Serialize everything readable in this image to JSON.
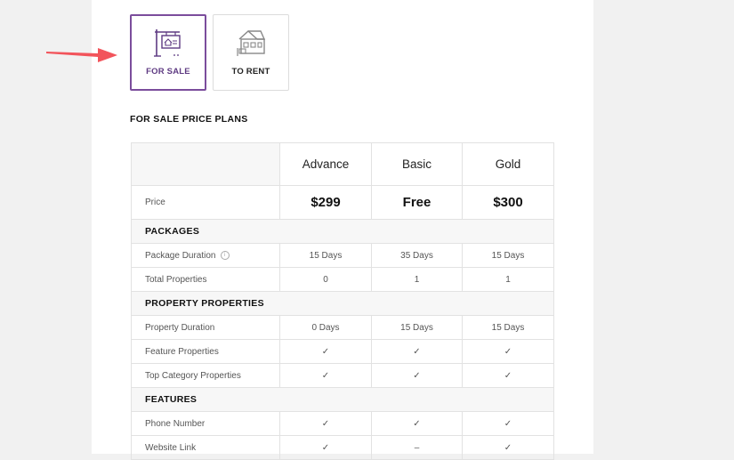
{
  "tabs": [
    {
      "label": "FOR SALE",
      "icon": "for-sale-sign-icon",
      "active": true
    },
    {
      "label": "TO RENT",
      "icon": "house-icon",
      "active": false
    }
  ],
  "section_title": "FOR SALE PRICE PLANS",
  "plans": [
    "Advance",
    "Basic",
    "Gold"
  ],
  "price": {
    "label": "Price",
    "values": [
      "$299",
      "Free",
      "$300"
    ]
  },
  "groups": {
    "packages": "PACKAGES",
    "property_properties": "PROPERTY PROPERTIES",
    "features": "FEATURES"
  },
  "rows": {
    "package_duration": {
      "label": "Package Duration",
      "values": [
        "15 Days",
        "35 Days",
        "15 Days"
      ]
    },
    "total_properties": {
      "label": "Total Properties",
      "values": [
        "0",
        "1",
        "1"
      ]
    },
    "property_duration": {
      "label": "Property Duration",
      "values": [
        "0 Days",
        "15 Days",
        "15 Days"
      ]
    },
    "feature_properties": {
      "label": "Feature Properties",
      "values": [
        "✓",
        "✓",
        "✓"
      ]
    },
    "top_category_properties": {
      "label": "Top Category Properties",
      "values": [
        "✓",
        "✓",
        "✓"
      ]
    },
    "phone_number": {
      "label": "Phone Number",
      "values": [
        "✓",
        "✓",
        "✓"
      ]
    },
    "website_link": {
      "label": "Website Link",
      "values": [
        "✓",
        "–",
        "✓"
      ]
    }
  },
  "colors": {
    "accent": "#7b4d9c",
    "check": "#4caf50",
    "arrow": "#f2545b"
  }
}
